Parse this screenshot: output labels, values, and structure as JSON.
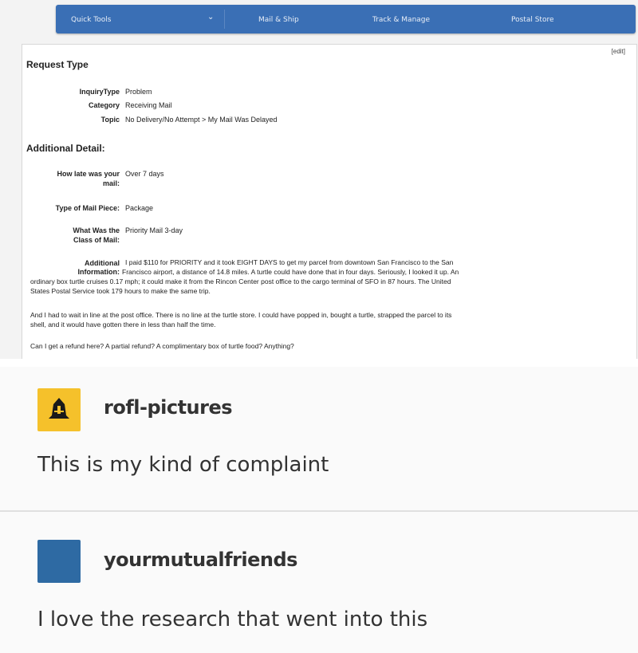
{
  "nav": {
    "quick_tools": "Quick Tools",
    "chevron": "⌄",
    "mail_ship": "Mail & Ship",
    "track_manage": "Track & Manage",
    "postal_store": "Postal Store"
  },
  "form": {
    "edit": "[edit]",
    "request_type": "Request Type",
    "inquiry_type_label": "InquiryType",
    "inquiry_type_value": "Problem",
    "category_label": "Category",
    "category_value": "Receiving Mail",
    "topic_label": "Topic",
    "topic_value": "No Delivery/No Attempt > My Mail Was Delayed",
    "additional_detail": "Additional Detail:",
    "how_late_label_1": "How late was your",
    "how_late_label_2": "mail:",
    "how_late_value": "Over 7 days",
    "mail_piece_label": "Type of Mail Piece:",
    "mail_piece_value": "Package",
    "class_label_1": "What Was the",
    "class_label_2": "Class of Mail:",
    "class_value": "Priority Mail 3-day",
    "addl_label_1": "Additional",
    "addl_label_2": "Information:",
    "addl_line_1": "I paid $110 for PRIORITY and it took EIGHT DAYS to get my parcel from downtown San Francisco to the San",
    "addl_line_2": "Francisco airport, a distance of 14.8 miles. A turtle could have done that in four days. Seriously, I looked it up. An",
    "addl_line_3": "ordinary box turtle cruises 0.17 mph; it could make it from the Rincon Center post office to the cargo terminal of SFO in 87 hours. The United",
    "addl_line_4": "States Postal Service took 179 hours to make the same trip.",
    "para2_line_1": "And I had to wait in line at the post office. There is no line at the turtle store. I could have popped in, bought a turtle, strapped the parcel to its",
    "para2_line_2": "shell, and it would have gotten there in less than half the time.",
    "para3": "Can I get a refund here? A partial refund? A complimentary box of turtle food? Anything?"
  },
  "posts": [
    {
      "username": "rofl-pictures",
      "text": "This is my kind of complaint"
    },
    {
      "username": "yourmutualfriends",
      "text": "I love the research that went into this"
    }
  ]
}
